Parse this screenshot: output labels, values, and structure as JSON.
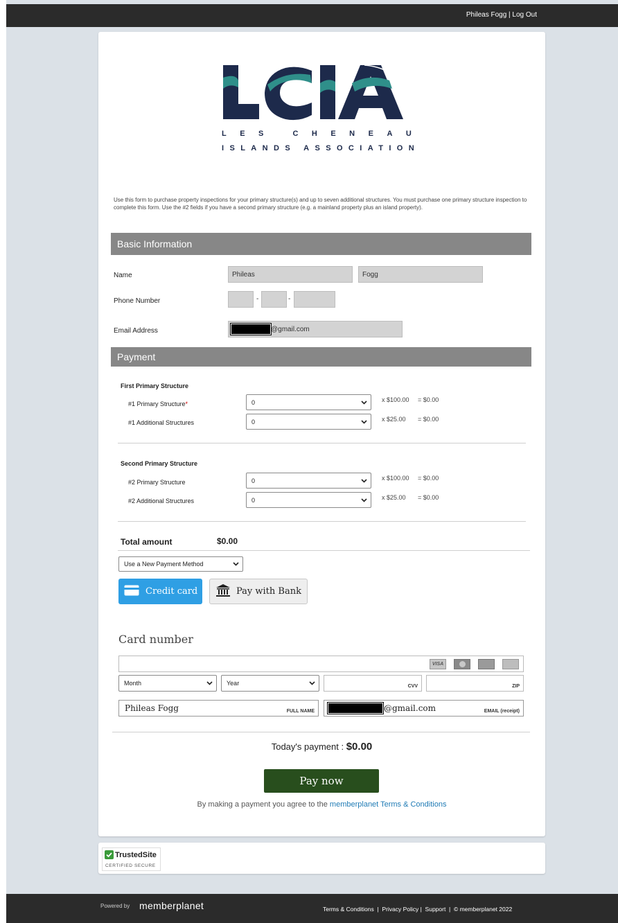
{
  "header": {
    "user_links": "Phileas Fogg | Log Out"
  },
  "logo": {
    "big": "LCIA",
    "line1": "LES CHENEAUX",
    "line2": "ISLANDS ASSOCIATION"
  },
  "intro": "Use this form to purchase property inspections for your primary structure(s) and up to seven additional structures. You must purchase one primary structure inspection to complete this form.  Use the #2 fields if you have a second primary structure (e.g. a mainland property plus an island property).",
  "basic": {
    "title": "Basic Information",
    "name_label": "Name",
    "first_name": "Phileas",
    "last_name": "Fogg",
    "phone_label": "Phone Number",
    "email_label": "Email Address",
    "email_value": "@gmail.com"
  },
  "payment": {
    "title": "Payment",
    "first": {
      "heading": "First Primary Structure",
      "rows": [
        {
          "label": "#1 Primary Structure",
          "value": "0",
          "price": "x $100.00",
          "total": "= $0.00"
        },
        {
          "label": "#1 Additional Structures",
          "value": "0",
          "price": "x $25.00",
          "total": "= $0.00"
        }
      ]
    },
    "second": {
      "heading": "Second Primary Structure",
      "rows": [
        {
          "label": "#2 Primary Structure",
          "value": "0",
          "price": "x $100.00",
          "total": "= $0.00"
        },
        {
          "label": "#2 Additional Structures",
          "value": "0",
          "price": "x $25.00",
          "total": "= $0.00"
        }
      ]
    },
    "required_mark": "*",
    "total_label": "Total amount",
    "total_value": "$0.00",
    "method_select": "Use a New Payment Method",
    "cc_button": "Credit card",
    "bank_button": "Pay with Bank",
    "card_title": "Card number",
    "card_logos": [
      "VISA",
      "",
      "",
      ""
    ],
    "month": "Month",
    "year": "Year",
    "cvv": "CVV",
    "zip": "ZIP",
    "full_name_value": "Phileas Fogg",
    "full_name_tag": "FULL NAME",
    "email_receipt_value": "@gmail.com",
    "email_receipt_tag": "EMAIL (receipt)",
    "todays_label": "Today's payment :",
    "todays_value": "$0.00",
    "pay_now": "Pay now",
    "agree_text": "By making a payment you agree to the",
    "agree_link": "memberplanet Terms & Conditions"
  },
  "trust": {
    "brand": "TrustedSite",
    "sub": "CERTIFIED SECURE"
  },
  "footer": {
    "powered": "Powered by",
    "brand": "memberplanet",
    "links": "Terms & Conditions  |  Privacy Policy |  Support  |  © memberplanet 2022"
  },
  "colors": {
    "accent_blue": "#2f9fe4",
    "pay_green": "#284e1d",
    "section_gray": "#878787",
    "link": "#1f7bb5",
    "logo_navy": "#1d2a4b",
    "logo_teal": "#2f8f8a"
  }
}
